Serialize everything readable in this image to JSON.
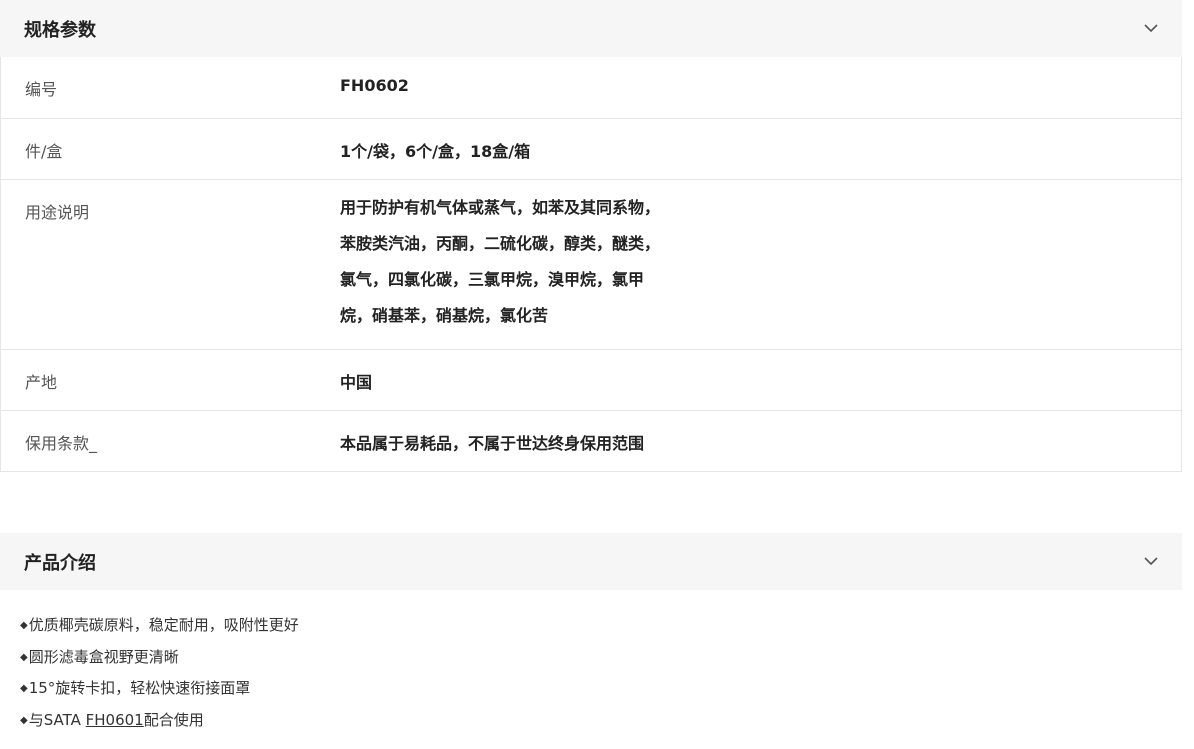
{
  "specs": {
    "title": "规格参数",
    "rows": [
      {
        "label": "编号",
        "value": "FH0602"
      },
      {
        "label": "件/盒",
        "value": "1个/袋，6个/盒，18盒/箱"
      },
      {
        "label": "用途说明",
        "lines": [
          "用于防护有机气体或蒸气，如苯及其同系物，",
          "苯胺类汽油，丙酮，二硫化碳，醇类，醚类，",
          "氯气，四氯化碳，三氯甲烷，溴甲烷，氯甲",
          "烷，硝基苯，硝基烷，氯化苦"
        ]
      },
      {
        "label": "产地",
        "value": "中国"
      },
      {
        "label": "保用条款_",
        "value": "本品属于易耗品，不属于世达终身保用范围"
      }
    ]
  },
  "intro": {
    "title": "产品介绍",
    "bullet": "◆",
    "items": [
      "优质椰壳碳原料，稳定耐用，吸附性更好",
      "圆形滤毒盒视野更清晰",
      "15°旋转卡扣，轻松快速衔接面罩"
    ],
    "last_item": {
      "prefix": "与SATA ",
      "link": "FH0601",
      "suffix": "配合使用"
    }
  },
  "icons": {
    "collapse": "chevron-down-icon"
  }
}
